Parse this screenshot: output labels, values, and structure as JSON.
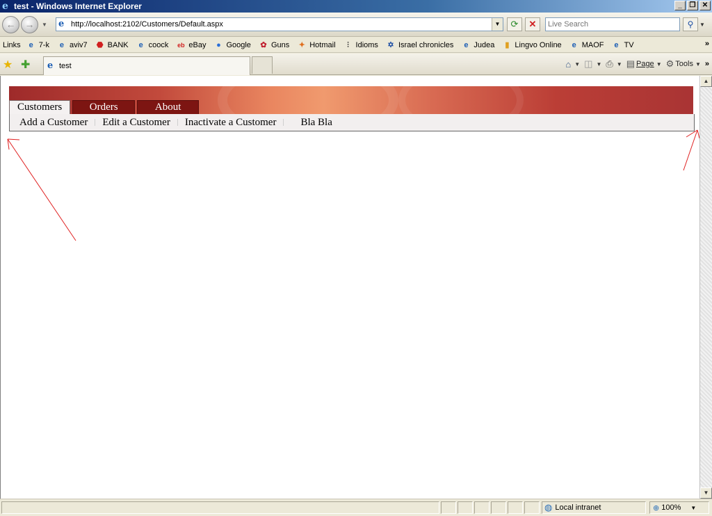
{
  "window": {
    "title": "test - Windows Internet Explorer"
  },
  "address": {
    "url": "http://localhost:2102/Customers/Default.aspx"
  },
  "search": {
    "placeholder": "Live Search"
  },
  "links": {
    "label": "Links",
    "items": [
      "7-k",
      "aviv7",
      "BANK",
      "coock",
      "eBay",
      "Google",
      "Guns",
      "Hotmail",
      "Idioms",
      "Israel chronicles",
      "Judea",
      "Lingvo Online",
      "MAOF",
      "TV"
    ]
  },
  "browser_tab": {
    "title": "test"
  },
  "commandbar": {
    "page_label": "Page",
    "tools_label": "Tools"
  },
  "site": {
    "menu": [
      "Customers",
      "Orders",
      "About"
    ],
    "submenu": [
      "Add a Customer",
      "Edit a Customer",
      "Inactivate a Customer",
      "Bla Bla"
    ]
  },
  "status": {
    "zone": "Local intranet",
    "zoom": "100%"
  },
  "colors": {
    "menu_tab_bg": "#7d1512",
    "header_accent": "#e9855f",
    "annotation_arrow": "#e02020"
  }
}
